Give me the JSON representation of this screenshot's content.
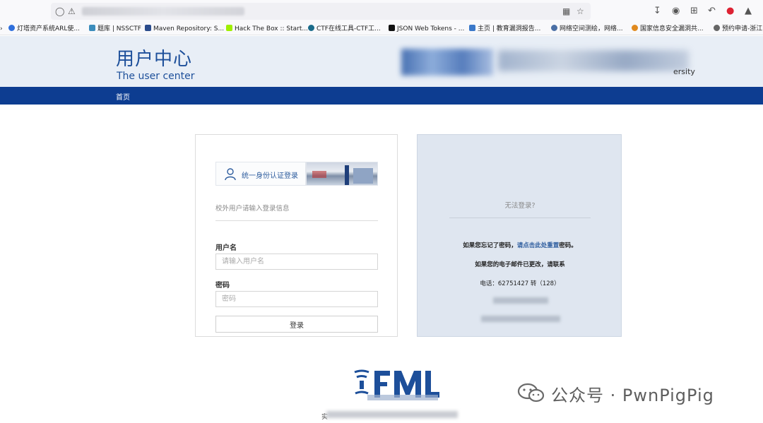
{
  "browser": {
    "bookmarks": [
      {
        "label": "灯塔资产系统ARL使...",
        "color": "#2f6fdc"
      },
      {
        "label": "题库 | NSSCTF",
        "color": "#3c8dbc"
      },
      {
        "label": "Maven Repository: S...",
        "color": "#2b4c8c"
      },
      {
        "label": "Hack The Box :: Start...",
        "color": "#9fef00"
      },
      {
        "label": "CTF在线工具-CTF工...",
        "color": "#1a6b8a"
      },
      {
        "label": "JSON Web Tokens - ...",
        "color": "#111111"
      },
      {
        "label": "主页 | 教育漏洞报告...",
        "color": "#3a78c9"
      },
      {
        "label": "网络空间测绘，网络...",
        "color": "#4a6fa5"
      },
      {
        "label": "国家信息安全漏洞共...",
        "color": "#e08a1e"
      },
      {
        "label": "预约申请-浙江...",
        "color": "#666666"
      }
    ]
  },
  "header": {
    "title_cn": "用户中心",
    "title_en": "The user center",
    "tail_text": "ersity"
  },
  "nav": {
    "home": "首页"
  },
  "login": {
    "sso_label": "统一身份认证登录",
    "external_hint": "校外用户请输入登录信息",
    "username_label": "用户名",
    "username_placeholder": "请输入用户名",
    "password_label": "密码",
    "password_placeholder": "密码",
    "submit_label": "登录"
  },
  "help": {
    "title": "无法登录?",
    "forgot_prefix": "如果您忘记了密码，",
    "forgot_link": "请点击此处重置",
    "forgot_suffix": "密码。",
    "email_changed": "如果您的电子邮件已更改，请联系",
    "phone": "电话：62751427 转（128）"
  },
  "footer": {
    "char": "实"
  },
  "watermark": {
    "text": "公众号 · PwnPigPig"
  },
  "colors": {
    "brand_blue": "#1d4f9a",
    "nav_blue": "#0d3d91",
    "header_bg": "#e8eef6",
    "help_bg": "#dfe6f0"
  }
}
